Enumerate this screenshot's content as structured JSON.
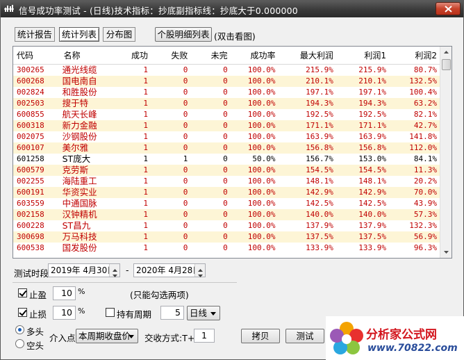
{
  "window": {
    "title": "信号成功率测试 - (日线)技术指标：抄底副指标线：抄底大于0.000000"
  },
  "tabs": [
    {
      "label": "统计报告",
      "active": false
    },
    {
      "label": "统计列表",
      "active": true
    },
    {
      "label": "分布图",
      "active": false
    }
  ],
  "detail_button": "个股明细列表",
  "detail_hint": "(双击看图)",
  "table": {
    "columns": [
      "代码",
      "名称",
      "成功",
      "失败",
      "未完",
      "成功率",
      "最大利润",
      "利润1",
      "利润2"
    ],
    "rows": [
      {
        "code": "300265",
        "name": "通光线缆",
        "success": "1",
        "fail": "0",
        "pending": "0",
        "rate": "100.0%",
        "max_profit": "215.9%",
        "profit1": "215.9%",
        "profit2": "80.7%",
        "color": "red"
      },
      {
        "code": "600268",
        "name": "国电南自",
        "success": "1",
        "fail": "0",
        "pending": "0",
        "rate": "100.0%",
        "max_profit": "210.1%",
        "profit1": "210.1%",
        "profit2": "132.5%",
        "color": "red"
      },
      {
        "code": "002824",
        "name": "和胜股份",
        "success": "1",
        "fail": "0",
        "pending": "0",
        "rate": "100.0%",
        "max_profit": "197.1%",
        "profit1": "197.1%",
        "profit2": "100.4%",
        "color": "red"
      },
      {
        "code": "002503",
        "name": "搜于特",
        "success": "1",
        "fail": "0",
        "pending": "0",
        "rate": "100.0%",
        "max_profit": "194.3%",
        "profit1": "194.3%",
        "profit2": "63.2%",
        "color": "red"
      },
      {
        "code": "600855",
        "name": "航天长峰",
        "success": "1",
        "fail": "0",
        "pending": "0",
        "rate": "100.0%",
        "max_profit": "192.5%",
        "profit1": "192.5%",
        "profit2": "82.1%",
        "color": "red"
      },
      {
        "code": "600318",
        "name": "新力金融",
        "success": "1",
        "fail": "0",
        "pending": "0",
        "rate": "100.0%",
        "max_profit": "171.1%",
        "profit1": "171.1%",
        "profit2": "42.7%",
        "color": "red"
      },
      {
        "code": "002075",
        "name": "沙钢股份",
        "success": "1",
        "fail": "0",
        "pending": "0",
        "rate": "100.0%",
        "max_profit": "163.9%",
        "profit1": "163.9%",
        "profit2": "141.8%",
        "color": "red"
      },
      {
        "code": "600107",
        "name": "美尔雅",
        "success": "1",
        "fail": "0",
        "pending": "0",
        "rate": "100.0%",
        "max_profit": "156.8%",
        "profit1": "156.8%",
        "profit2": "112.0%",
        "color": "red"
      },
      {
        "code": "601258",
        "name": "ST庞大",
        "success": "1",
        "fail": "1",
        "pending": "0",
        "rate": "50.0%",
        "max_profit": "156.7%",
        "profit1": "153.0%",
        "profit2": "84.1%",
        "color": "black"
      },
      {
        "code": "600579",
        "name": "克劳斯",
        "success": "1",
        "fail": "0",
        "pending": "0",
        "rate": "100.0%",
        "max_profit": "154.5%",
        "profit1": "154.5%",
        "profit2": "11.3%",
        "color": "red"
      },
      {
        "code": "002255",
        "name": "海陆重工",
        "success": "1",
        "fail": "0",
        "pending": "0",
        "rate": "100.0%",
        "max_profit": "148.1%",
        "profit1": "148.1%",
        "profit2": "20.2%",
        "color": "red"
      },
      {
        "code": "600191",
        "name": "华资实业",
        "success": "1",
        "fail": "0",
        "pending": "0",
        "rate": "100.0%",
        "max_profit": "142.9%",
        "profit1": "142.9%",
        "profit2": "70.0%",
        "color": "red"
      },
      {
        "code": "603559",
        "name": "中通国脉",
        "success": "1",
        "fail": "0",
        "pending": "0",
        "rate": "100.0%",
        "max_profit": "142.5%",
        "profit1": "142.5%",
        "profit2": "43.9%",
        "color": "red"
      },
      {
        "code": "002158",
        "name": "汉钟精机",
        "success": "1",
        "fail": "0",
        "pending": "0",
        "rate": "100.0%",
        "max_profit": "140.0%",
        "profit1": "140.0%",
        "profit2": "57.3%",
        "color": "red"
      },
      {
        "code": "600228",
        "name": "ST昌九",
        "success": "1",
        "fail": "0",
        "pending": "0",
        "rate": "100.0%",
        "max_profit": "137.9%",
        "profit1": "137.9%",
        "profit2": "132.3%",
        "color": "red"
      },
      {
        "code": "300698",
        "name": "万马科技",
        "success": "1",
        "fail": "0",
        "pending": "0",
        "rate": "100.0%",
        "max_profit": "137.5%",
        "profit1": "137.5%",
        "profit2": "56.9%",
        "color": "red"
      },
      {
        "code": "600538",
        "name": "国发股份",
        "success": "1",
        "fail": "0",
        "pending": "0",
        "rate": "100.0%",
        "max_profit": "133.9%",
        "profit1": "133.9%",
        "profit2": "96.3%",
        "color": "red"
      }
    ]
  },
  "test_period": {
    "label": "测试时段",
    "start": "2019年  4月30日",
    "separator": "-",
    "end": "2020年  4月28日"
  },
  "take_profit": {
    "label": "止盈",
    "checked": true,
    "value": "10",
    "unit": "%"
  },
  "stop_loss": {
    "label": "止损",
    "checked": true,
    "value": "10",
    "unit": "%"
  },
  "choose_hint": "(只能勾选两项)",
  "holding_period": {
    "label": "持有周期",
    "checked": false,
    "value": "5",
    "unit_option": "日线"
  },
  "direction": [
    {
      "label": "多头",
      "checked": true
    },
    {
      "label": "空头",
      "checked": false
    }
  ],
  "entry": {
    "label": "介入点",
    "value": "本周期收盘价"
  },
  "trade_mode": {
    "label": "交收方式:T+",
    "value": "1"
  },
  "buttons": {
    "copy": "拷贝",
    "test": "测试"
  },
  "watermark": {
    "name": "分析家公式网",
    "url": "www.70822.com"
  },
  "colors": {
    "red_text": "#c00000",
    "even_row": "#fdf5d6",
    "title_bar": "#3a3a3a",
    "logo_red": "#d3161e",
    "logo_blue": "#2a4d9b"
  }
}
